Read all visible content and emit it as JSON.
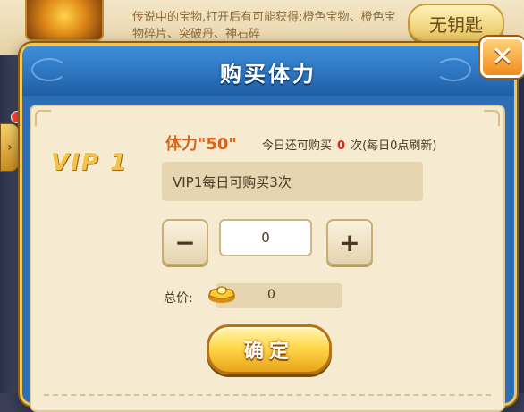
{
  "background": {
    "item_description": "传说中的宝物,打开后有可能获得:橙色宝物、橙色宝物碎片、突破丹、神石碎",
    "no_key_button": "无钥匙",
    "arrow_tab": "›"
  },
  "dialog": {
    "title": "购买体力",
    "close_icon": "✕",
    "vip_label": "VIP 1",
    "stamina_title": "体力\"50\"",
    "limit_prefix": "今日还可购买",
    "remaining_count": "0",
    "limit_suffix": "次(每日0点刷新)",
    "vip_info": "VIP1每日可购买3次",
    "minus_label": "−",
    "plus_label": "+",
    "quantity_value": "0",
    "total_label": "总价:",
    "total_value": "0",
    "confirm_label": "确定"
  },
  "colors": {
    "header_blue": "#2d6fb6",
    "panel_cream": "#f6ead0",
    "accent_gold": "#f0c455",
    "accent_orange": "#d8631a",
    "count_red": "#e0221a"
  },
  "icons": [
    "close-icon",
    "gold-ingot-icon",
    "minus-icon",
    "plus-icon",
    "arrow-right-icon"
  ]
}
